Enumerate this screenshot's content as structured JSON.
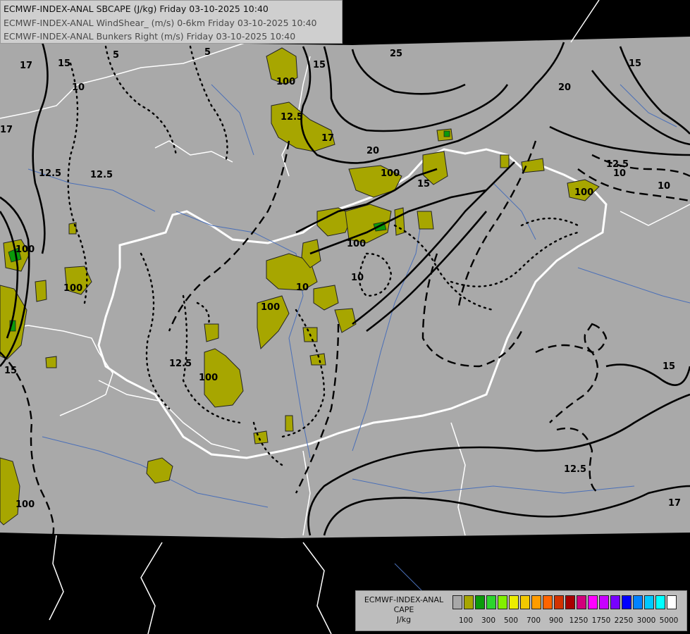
{
  "title": {
    "line1": "ECMWF-INDEX-ANAL SBCAPE (J/kg) Friday 03-10-2025 10:40",
    "line2": "ECMWF-INDEX-ANAL WindShear_ (m/s) 0-6km Friday 03-10-2025 10:40",
    "line3": "ECMWF-INDEX-ANAL Bunkers Right (m/s) Friday 03-10-2025 10:40"
  },
  "legend": {
    "line1": "ECMWF-INDEX-ANAL",
    "line2": "CAPE",
    "line3": "J/kg",
    "colors": [
      "#a8a8a8",
      "#a7a600",
      "#0a9a0a",
      "#2cd52c",
      "#82f000",
      "#ecec00",
      "#f2c800",
      "#ff9c00",
      "#ff6400",
      "#d23200",
      "#a80000",
      "#d2007c",
      "#ff00ff",
      "#c800ff",
      "#7800ff",
      "#0000ff",
      "#0082ff",
      "#00c8ff",
      "#00ffff",
      "#ffffff"
    ],
    "ticks": [
      "100",
      "300",
      "500",
      "700",
      "900",
      "1250",
      "1750",
      "2250",
      "3000",
      "5000"
    ]
  },
  "contour_labels": {
    "cape": [
      "100",
      "100",
      "100",
      "100",
      "100",
      "100",
      "100",
      "100",
      "100"
    ],
    "shear": [
      "15",
      "10",
      "12.5",
      "17",
      "17",
      "12.5",
      "15",
      "17",
      "12.5",
      "20",
      "15",
      "20",
      "15",
      "12.5",
      "10",
      "15",
      "17",
      "12.5",
      "25",
      "10",
      "15"
    ],
    "bunkers": [
      "5",
      "5",
      "10",
      "12.5",
      "10"
    ]
  }
}
